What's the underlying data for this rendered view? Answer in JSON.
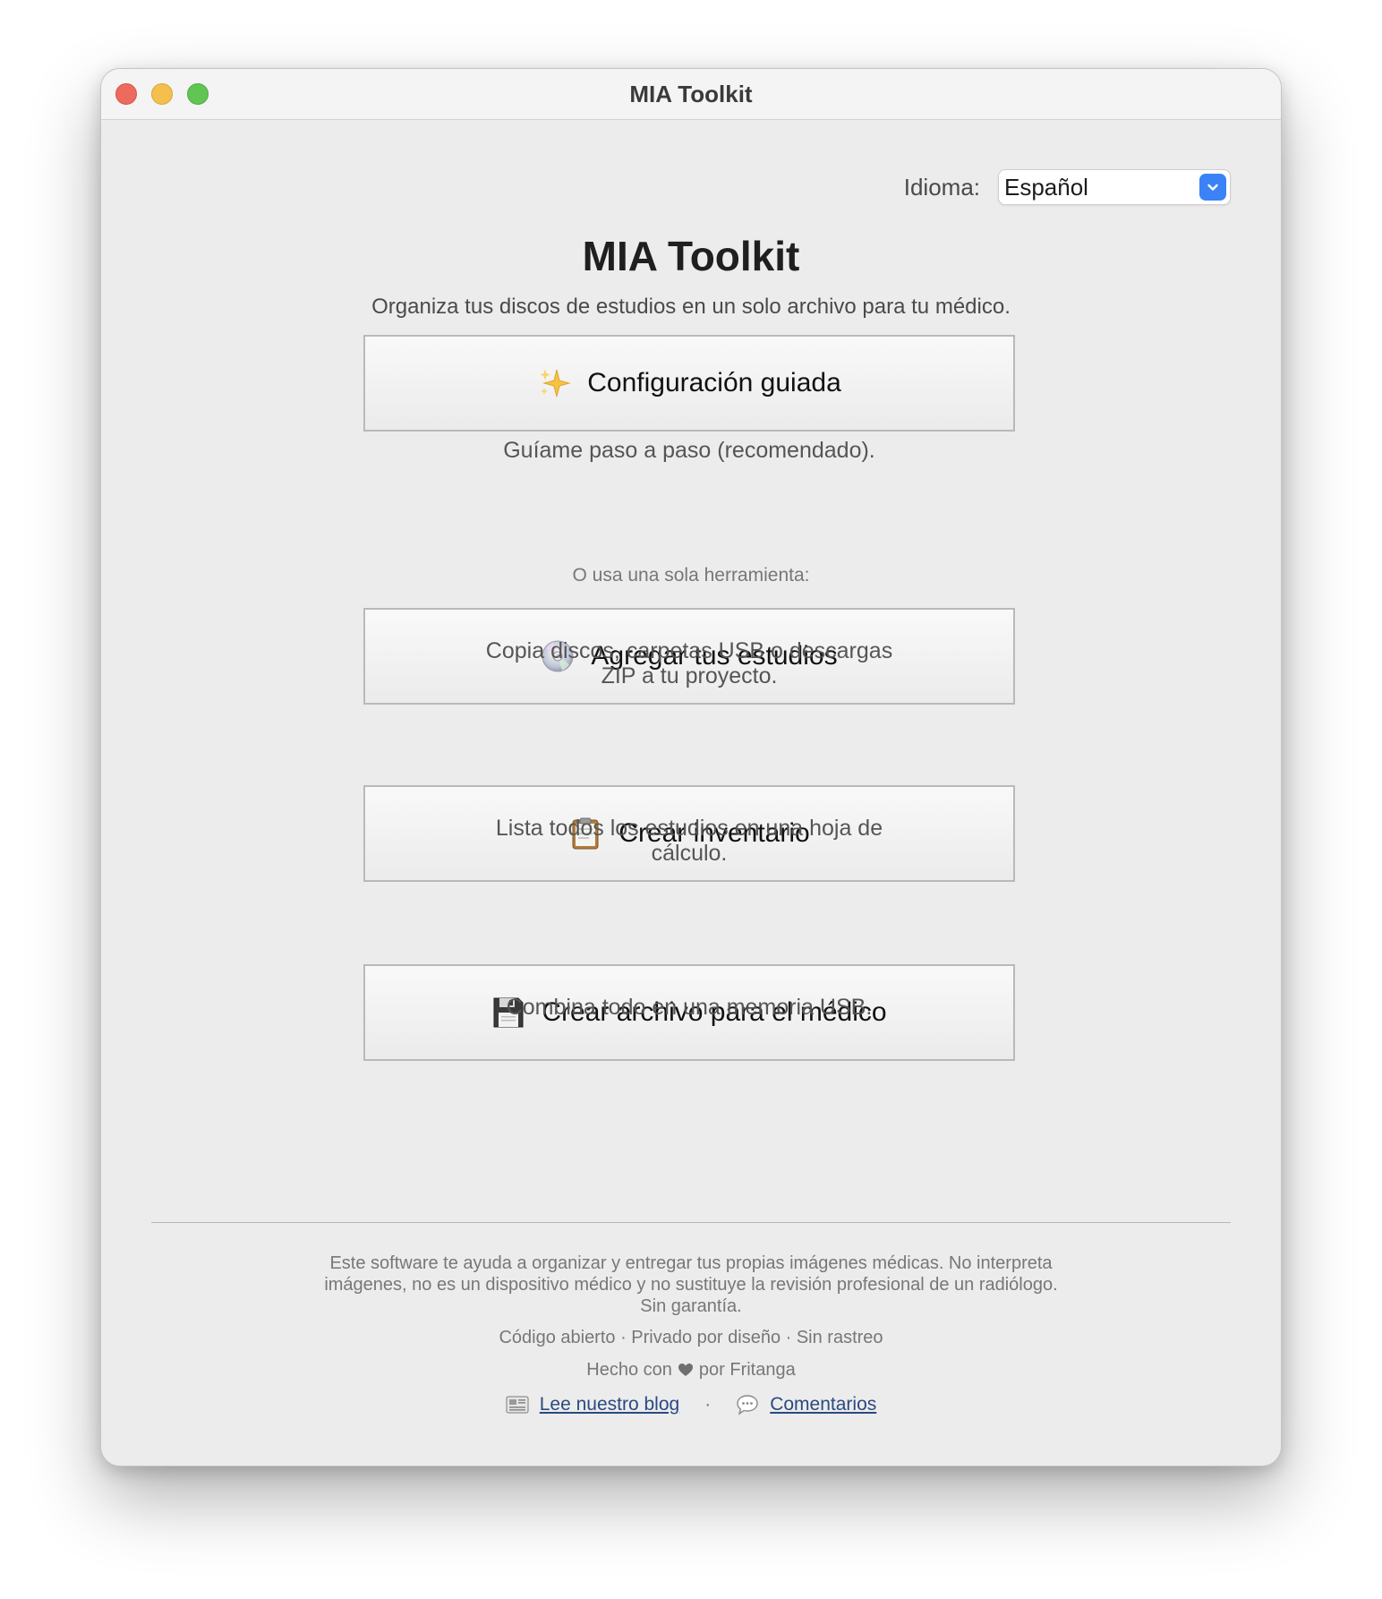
{
  "window": {
    "title": "MIA Toolkit"
  },
  "language": {
    "label": "Idioma:",
    "selected": "Español"
  },
  "header": {
    "title": "MIA Toolkit",
    "subtitle": "Organiza tus discos de estudios en un solo archivo para tu médico."
  },
  "guided": {
    "icon": "sparkles-icon",
    "label": "Configuración guiada",
    "description": "Guíame paso a paso (recomendado)."
  },
  "tools_label": "O usa una sola herramienta:",
  "tools": [
    {
      "icon": "disc-icon",
      "label": "Agregar tus estudios",
      "description_1": "Copia discos, carpetas USB o descargas",
      "description_2": "ZIP a tu proyecto."
    },
    {
      "icon": "clipboard-icon",
      "label": "Crear inventario",
      "description_1": "Lista todos los estudios en una hoja de",
      "description_2": "cálculo."
    },
    {
      "icon": "floppy-disk-icon",
      "label": "Crear archivo para el médico",
      "description_1": "Combina todo en una memoria USB."
    }
  ],
  "footer": {
    "disclaimer_1": "Este software te ayuda a organizar y entregar tus propias imágenes médicas. No interpreta",
    "disclaimer_2": "imágenes, no es un dispositivo médico y no sustituye la revisión profesional de un radiólogo.",
    "disclaimer_3": "Sin garantía.",
    "values": "Código abierto · Privado por diseño · Sin rastreo",
    "made_prefix": "Hecho con",
    "made_suffix": "por Fritanga",
    "blog_link": "Lee nuestro blog",
    "link_separator": "·",
    "feedback_link": "Comentarios"
  },
  "colors": {
    "accent": "#3b82f6",
    "close": "#ed6a5e",
    "minimize": "#f5bf4f",
    "maximize": "#61c554",
    "link": "#2a4a80"
  }
}
